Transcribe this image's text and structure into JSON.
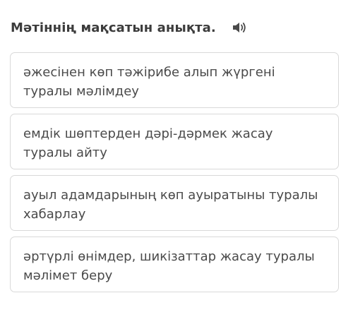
{
  "question": {
    "title": "Мәтіннің мақсатын анықта.",
    "audio_icon": "speaker-icon"
  },
  "options": [
    {
      "label": "әжесінен көп тәжірибе алып жүргені туралы мәлімдеу"
    },
    {
      "label": "емдік шөптерден дәрі-дәрмек жасау туралы айту"
    },
    {
      "label": "ауыл адамдарының көп ауыратыны туралы хабарлау"
    },
    {
      "label": "әртүрлі өнімдер, шикізаттар жасау туралы мәлімет беру"
    }
  ],
  "colors": {
    "title": "#3c3c3c",
    "option_text": "#4a4a4a",
    "option_border": "#d9d9d9",
    "icon": "#4a4a4a"
  }
}
